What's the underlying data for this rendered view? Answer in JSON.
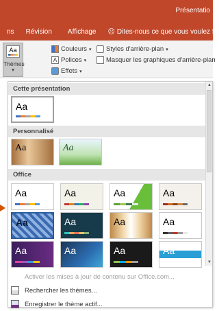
{
  "window": {
    "title": "Présentatio"
  },
  "tabs": [
    {
      "label": "ns"
    },
    {
      "label": "Révision"
    },
    {
      "label": "Affichage"
    }
  ],
  "tell_me": {
    "placeholder": "Dites-nous ce que vous voulez fa"
  },
  "ribbon": {
    "themes_label": "Thèmes",
    "themes_icon_text": "Aa",
    "colors": "Couleurs",
    "fonts": "Polices",
    "effects": "Effets",
    "bg_styles": "Styles d'arrière-plan",
    "hide_bg": "Masquer les graphiques d'arrière-plan"
  },
  "gallery": {
    "sections": [
      {
        "label": "Cette présentation"
      },
      {
        "label": "Personnalisé"
      },
      {
        "label": "Office"
      }
    ],
    "thumb_text": "Aa",
    "office_thumb_text": "Aa"
  },
  "menu": {
    "update_content": "Activer les mises à jour de contenu sur Office.com...",
    "browse": "Rechercher les thèmes...",
    "save": "Enregistrer le thème actif..."
  },
  "colors": {
    "accent": "#c0472a",
    "pointer": "#d35400"
  }
}
